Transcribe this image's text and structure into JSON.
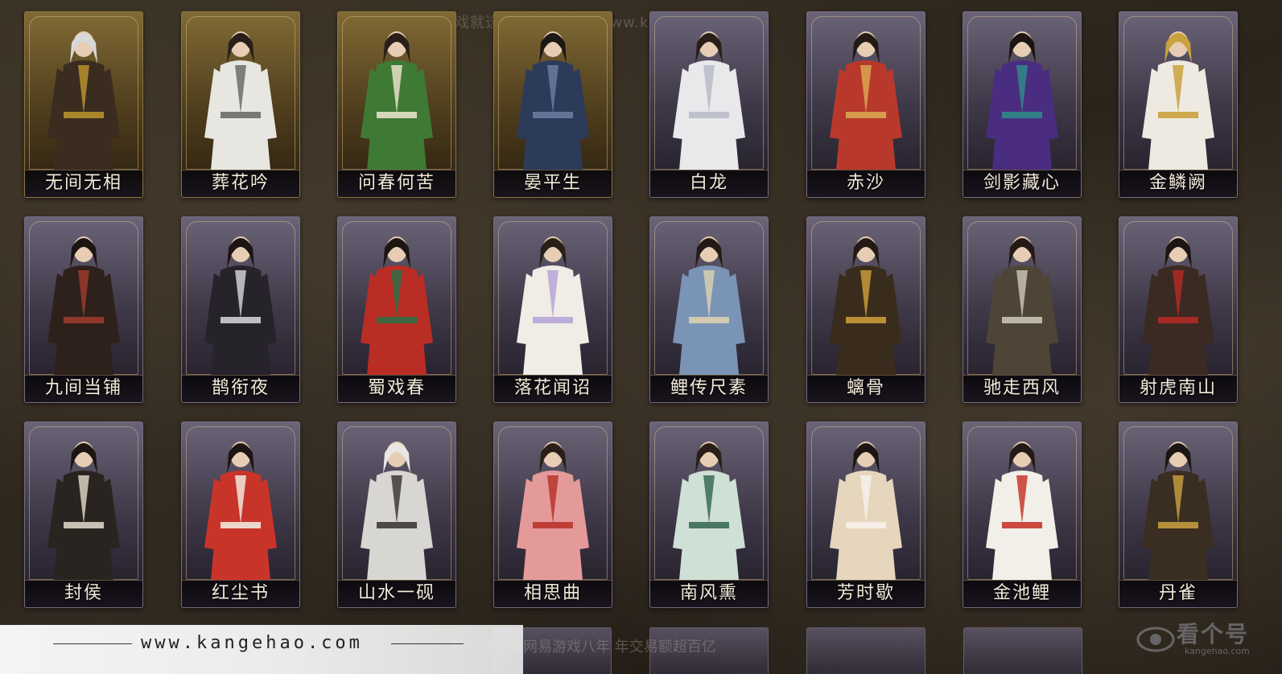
{
  "watermark_top": "网易游戏就选看个号   网址：www.kangehao.com",
  "cards": [
    {
      "name": "无间无相",
      "style": "gold",
      "robe": "#3a2c1f",
      "accent": "#b8902f",
      "hair": "#d8d8d8"
    },
    {
      "name": "葬花吟",
      "style": "gold",
      "robe": "#e8e6e0",
      "accent": "#6b6b6b",
      "hair": "#2a1f18"
    },
    {
      "name": "问春何苦",
      "style": "gold",
      "robe": "#3f7a34",
      "accent": "#e7e1c8",
      "hair": "#2a1f18"
    },
    {
      "name": "晏平生",
      "style": "gold",
      "robe": "#2d3b5a",
      "accent": "#6a7ba0",
      "hair": "#1e1814"
    },
    {
      "name": "白龙",
      "style": "purple",
      "robe": "#e9e9ec",
      "accent": "#b9bcc8",
      "hair": "#2a1f18"
    },
    {
      "name": "赤沙",
      "style": "purple",
      "robe": "#b8392b",
      "accent": "#d9a650",
      "hair": "#241a15"
    },
    {
      "name": "剑影藏心",
      "style": "purple",
      "robe": "#4a2d80",
      "accent": "#2f8a87",
      "hair": "#1c1512"
    },
    {
      "name": "金鳞阙",
      "style": "purple",
      "robe": "#eeeae2",
      "accent": "#c9a13d",
      "hair": "#c9a13d"
    },
    {
      "name": "九间当铺",
      "style": "purple",
      "robe": "#2e211b",
      "accent": "#9a3b2b",
      "hair": "#1c1512"
    },
    {
      "name": "鹊衔夜",
      "style": "purple",
      "robe": "#26232a",
      "accent": "#cfcfd4",
      "hair": "#1c1512"
    },
    {
      "name": "蜀戏春",
      "style": "purple",
      "robe": "#b92d25",
      "accent": "#2f6d45",
      "hair": "#1c1512"
    },
    {
      "name": "落花闻诏",
      "style": "purple",
      "robe": "#f0ece6",
      "accent": "#b7a6d6",
      "hair": "#2a1f18"
    },
    {
      "name": "鲤传尺素",
      "style": "purple",
      "robe": "#7a94b6",
      "accent": "#d9cfb0",
      "hair": "#241a15"
    },
    {
      "name": "螭骨",
      "style": "purple",
      "robe": "#3a2c1c",
      "accent": "#c99a3a",
      "hair": "#241a15"
    },
    {
      "name": "驰走西风",
      "style": "purple",
      "robe": "#4e4536",
      "accent": "#c8c2b2",
      "hair": "#241a15"
    },
    {
      "name": "射虎南山",
      "style": "purple",
      "robe": "#3a2a22",
      "accent": "#b22a25",
      "hair": "#1c1512"
    },
    {
      "name": "封侯",
      "style": "purple",
      "robe": "#2a2420",
      "accent": "#d8d2c4",
      "hair": "#1c1512"
    },
    {
      "name": "红尘书",
      "style": "purple",
      "robe": "#c9342a",
      "accent": "#f0e8de",
      "hair": "#1c1512"
    },
    {
      "name": "山水一砚",
      "style": "purple",
      "robe": "#d8d6d2",
      "accent": "#3d3a38",
      "hair": "#e8e6e2"
    },
    {
      "name": "相思曲",
      "style": "purple",
      "robe": "#e59a9a",
      "accent": "#b8352c",
      "hair": "#2a1f18"
    },
    {
      "name": "南风熏",
      "style": "purple",
      "robe": "#cfe0d6",
      "accent": "#3a6a58",
      "hair": "#2a1f18"
    },
    {
      "name": "芳时歇",
      "style": "purple",
      "robe": "#e6d6bd",
      "accent": "#f5f1ea",
      "hair": "#1c1512"
    },
    {
      "name": "金池鲤",
      "style": "purple",
      "robe": "#f2efe9",
      "accent": "#c8362b",
      "hair": "#241a15"
    },
    {
      "name": "丹雀",
      "style": "purple",
      "robe": "#3a2e22",
      "accent": "#c49a40",
      "hair": "#1c1512"
    }
  ],
  "bottom_bar": {
    "url": "www.kangehao.com"
  },
  "slogan": "看个号专业网易游戏八年   年交易额超百亿",
  "logo": {
    "text": "看个号",
    "sub": "kangehao.com"
  }
}
